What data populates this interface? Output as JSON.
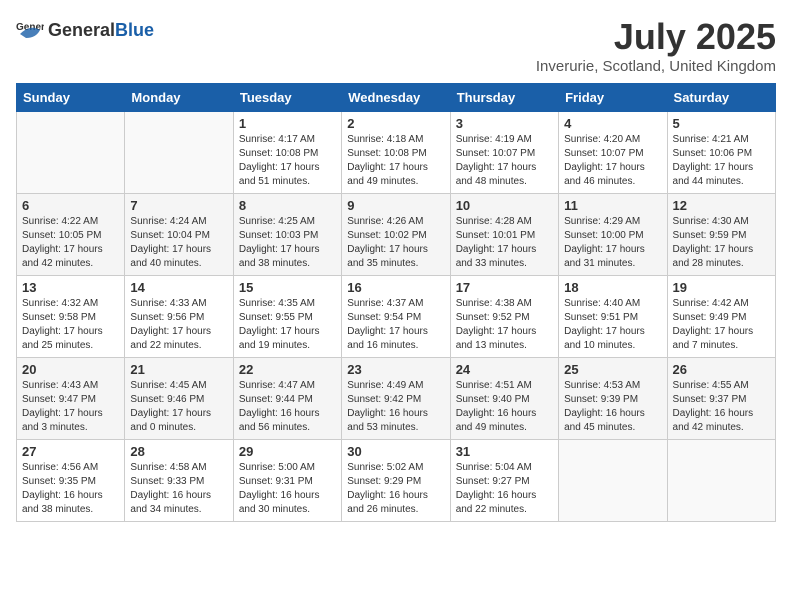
{
  "header": {
    "logo_general": "General",
    "logo_blue": "Blue",
    "month": "July 2025",
    "location": "Inverurie, Scotland, United Kingdom"
  },
  "weekdays": [
    "Sunday",
    "Monday",
    "Tuesday",
    "Wednesday",
    "Thursday",
    "Friday",
    "Saturday"
  ],
  "weeks": [
    [
      {
        "day": "",
        "info": ""
      },
      {
        "day": "",
        "info": ""
      },
      {
        "day": "1",
        "info": "Sunrise: 4:17 AM\nSunset: 10:08 PM\nDaylight: 17 hours\nand 51 minutes."
      },
      {
        "day": "2",
        "info": "Sunrise: 4:18 AM\nSunset: 10:08 PM\nDaylight: 17 hours\nand 49 minutes."
      },
      {
        "day": "3",
        "info": "Sunrise: 4:19 AM\nSunset: 10:07 PM\nDaylight: 17 hours\nand 48 minutes."
      },
      {
        "day": "4",
        "info": "Sunrise: 4:20 AM\nSunset: 10:07 PM\nDaylight: 17 hours\nand 46 minutes."
      },
      {
        "day": "5",
        "info": "Sunrise: 4:21 AM\nSunset: 10:06 PM\nDaylight: 17 hours\nand 44 minutes."
      }
    ],
    [
      {
        "day": "6",
        "info": "Sunrise: 4:22 AM\nSunset: 10:05 PM\nDaylight: 17 hours\nand 42 minutes."
      },
      {
        "day": "7",
        "info": "Sunrise: 4:24 AM\nSunset: 10:04 PM\nDaylight: 17 hours\nand 40 minutes."
      },
      {
        "day": "8",
        "info": "Sunrise: 4:25 AM\nSunset: 10:03 PM\nDaylight: 17 hours\nand 38 minutes."
      },
      {
        "day": "9",
        "info": "Sunrise: 4:26 AM\nSunset: 10:02 PM\nDaylight: 17 hours\nand 35 minutes."
      },
      {
        "day": "10",
        "info": "Sunrise: 4:28 AM\nSunset: 10:01 PM\nDaylight: 17 hours\nand 33 minutes."
      },
      {
        "day": "11",
        "info": "Sunrise: 4:29 AM\nSunset: 10:00 PM\nDaylight: 17 hours\nand 31 minutes."
      },
      {
        "day": "12",
        "info": "Sunrise: 4:30 AM\nSunset: 9:59 PM\nDaylight: 17 hours\nand 28 minutes."
      }
    ],
    [
      {
        "day": "13",
        "info": "Sunrise: 4:32 AM\nSunset: 9:58 PM\nDaylight: 17 hours\nand 25 minutes."
      },
      {
        "day": "14",
        "info": "Sunrise: 4:33 AM\nSunset: 9:56 PM\nDaylight: 17 hours\nand 22 minutes."
      },
      {
        "day": "15",
        "info": "Sunrise: 4:35 AM\nSunset: 9:55 PM\nDaylight: 17 hours\nand 19 minutes."
      },
      {
        "day": "16",
        "info": "Sunrise: 4:37 AM\nSunset: 9:54 PM\nDaylight: 17 hours\nand 16 minutes."
      },
      {
        "day": "17",
        "info": "Sunrise: 4:38 AM\nSunset: 9:52 PM\nDaylight: 17 hours\nand 13 minutes."
      },
      {
        "day": "18",
        "info": "Sunrise: 4:40 AM\nSunset: 9:51 PM\nDaylight: 17 hours\nand 10 minutes."
      },
      {
        "day": "19",
        "info": "Sunrise: 4:42 AM\nSunset: 9:49 PM\nDaylight: 17 hours\nand 7 minutes."
      }
    ],
    [
      {
        "day": "20",
        "info": "Sunrise: 4:43 AM\nSunset: 9:47 PM\nDaylight: 17 hours\nand 3 minutes."
      },
      {
        "day": "21",
        "info": "Sunrise: 4:45 AM\nSunset: 9:46 PM\nDaylight: 17 hours\nand 0 minutes."
      },
      {
        "day": "22",
        "info": "Sunrise: 4:47 AM\nSunset: 9:44 PM\nDaylight: 16 hours\nand 56 minutes."
      },
      {
        "day": "23",
        "info": "Sunrise: 4:49 AM\nSunset: 9:42 PM\nDaylight: 16 hours\nand 53 minutes."
      },
      {
        "day": "24",
        "info": "Sunrise: 4:51 AM\nSunset: 9:40 PM\nDaylight: 16 hours\nand 49 minutes."
      },
      {
        "day": "25",
        "info": "Sunrise: 4:53 AM\nSunset: 9:39 PM\nDaylight: 16 hours\nand 45 minutes."
      },
      {
        "day": "26",
        "info": "Sunrise: 4:55 AM\nSunset: 9:37 PM\nDaylight: 16 hours\nand 42 minutes."
      }
    ],
    [
      {
        "day": "27",
        "info": "Sunrise: 4:56 AM\nSunset: 9:35 PM\nDaylight: 16 hours\nand 38 minutes."
      },
      {
        "day": "28",
        "info": "Sunrise: 4:58 AM\nSunset: 9:33 PM\nDaylight: 16 hours\nand 34 minutes."
      },
      {
        "day": "29",
        "info": "Sunrise: 5:00 AM\nSunset: 9:31 PM\nDaylight: 16 hours\nand 30 minutes."
      },
      {
        "day": "30",
        "info": "Sunrise: 5:02 AM\nSunset: 9:29 PM\nDaylight: 16 hours\nand 26 minutes."
      },
      {
        "day": "31",
        "info": "Sunrise: 5:04 AM\nSunset: 9:27 PM\nDaylight: 16 hours\nand 22 minutes."
      },
      {
        "day": "",
        "info": ""
      },
      {
        "day": "",
        "info": ""
      }
    ]
  ]
}
